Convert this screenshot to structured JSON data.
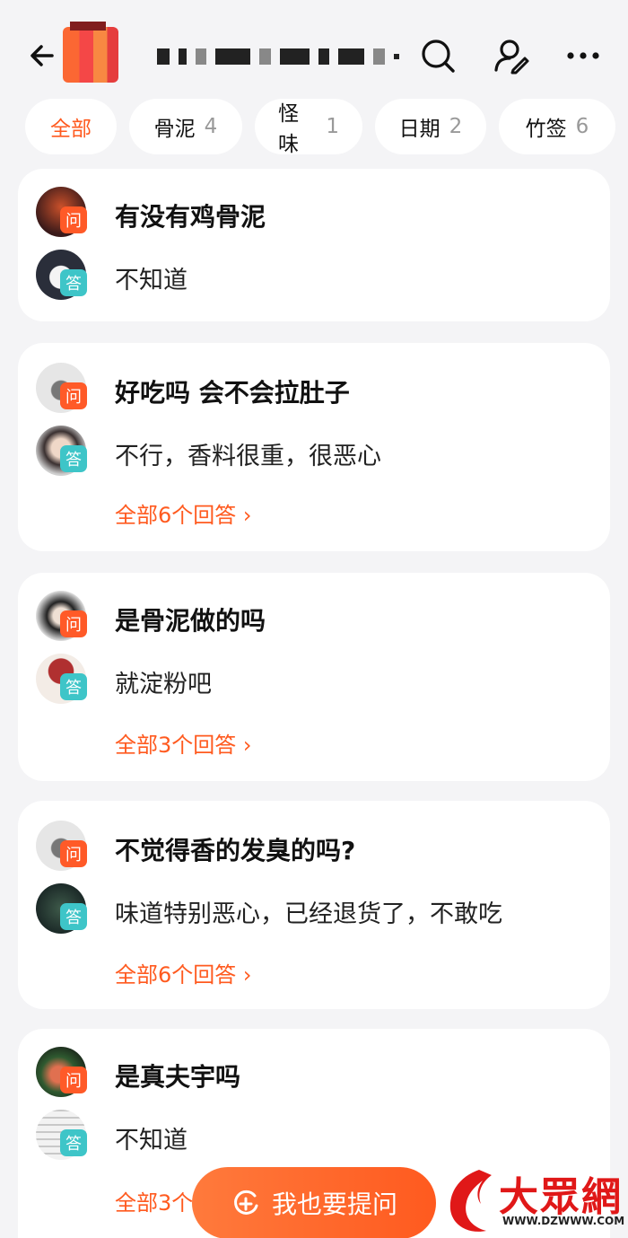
{
  "tabs": [
    {
      "label": "全部",
      "count": ""
    },
    {
      "label": "骨泥",
      "count": "4"
    },
    {
      "label": "怪味",
      "count": "1"
    },
    {
      "label": "日期",
      "count": "2"
    },
    {
      "label": "竹签",
      "count": "6"
    }
  ],
  "qa": [
    {
      "q_badge": "问",
      "question": "有没有鸡骨泥",
      "a_badge": "答",
      "answer": "不知道",
      "more": ""
    },
    {
      "q_badge": "问",
      "question": "好吃吗 会不会拉肚子",
      "a_badge": "答",
      "answer": "不行，香料很重，很恶心",
      "more": "全部6个回答 ›"
    },
    {
      "q_badge": "问",
      "question": "是骨泥做的吗",
      "a_badge": "答",
      "answer": "就淀粉吧",
      "more": "全部3个回答 ›"
    },
    {
      "q_badge": "问",
      "question": "不觉得香的发臭的吗?",
      "a_badge": "答",
      "answer": "味道特别恶心，已经退货了，不敢吃",
      "more": "全部6个回答 ›"
    },
    {
      "q_badge": "问",
      "question": "是真夫宇吗",
      "a_badge": "答",
      "answer": "不知道",
      "more": "全部3个回答 ›"
    }
  ],
  "ask_button": "我也要提问",
  "watermark": {
    "name": "大眾網",
    "url": "WWW.DZWWW.COM"
  },
  "colors": {
    "accent": "#ff5a1f",
    "answer_badge": "#3ec5c8",
    "question_badge": "#ff5a28"
  }
}
